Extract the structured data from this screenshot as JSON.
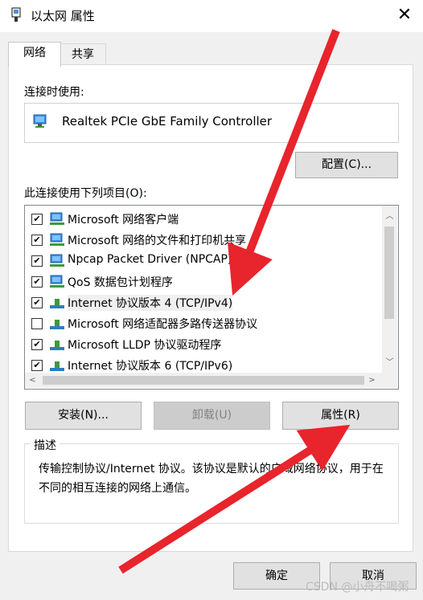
{
  "window": {
    "title": "以太网 属性",
    "close_glyph": "✕"
  },
  "tabs": [
    {
      "label": "网络",
      "active": true
    },
    {
      "label": "共享",
      "active": false
    }
  ],
  "connect_using": {
    "label": "连接时使用:",
    "adapter_name": "Realtek PCIe GbE Family Controller",
    "configure_button": "配置(C)..."
  },
  "items_section": {
    "label": "此连接使用下列项目(O):",
    "items": [
      {
        "checked": true,
        "icon": "network-client-icon",
        "label": "Microsoft 网络客户端"
      },
      {
        "checked": true,
        "icon": "network-client-icon",
        "label": "Microsoft 网络的文件和打印机共享"
      },
      {
        "checked": true,
        "icon": "network-client-icon",
        "label": "Npcap Packet Driver (NPCAP)"
      },
      {
        "checked": true,
        "icon": "network-client-icon",
        "label": "QoS 数据包计划程序"
      },
      {
        "checked": true,
        "icon": "protocol-icon",
        "label": "Internet 协议版本 4 (TCP/IPv4)",
        "selected": true
      },
      {
        "checked": false,
        "icon": "protocol-icon",
        "label": "Microsoft 网络适配器多路传送器协议"
      },
      {
        "checked": true,
        "icon": "protocol-icon",
        "label": "Microsoft LLDP 协议驱动程序"
      },
      {
        "checked": true,
        "icon": "protocol-icon",
        "label": "Internet 协议版本 6 (TCP/IPv6)"
      }
    ]
  },
  "buttons": {
    "install": "安装(N)...",
    "uninstall": "卸载(U)",
    "properties": "属性(R)"
  },
  "description": {
    "title": "描述",
    "text": "传输控制协议/Internet 协议。该协议是默认的广域网络协议，用于在不同的相互连接的网络上通信。"
  },
  "footer": {
    "ok": "确定",
    "cancel": "取消"
  },
  "watermark": "CSDN @小舟不喝粥",
  "colors": {
    "annotation_arrow": "#e8242c",
    "dialog_bg": "#f0f0f0",
    "button_bg": "#e1e1e1"
  }
}
